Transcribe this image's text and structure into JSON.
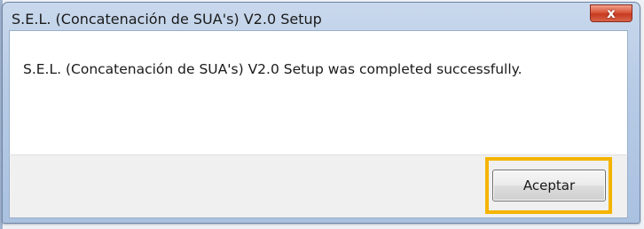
{
  "window": {
    "title": "S.E.L. (Concatenación de SUA's) V2.0 Setup",
    "close_glyph": "x"
  },
  "dialog": {
    "message": "S.E.L. (Concatenación de SUA's) V2.0 Setup was completed successfully."
  },
  "buttons": {
    "accept_label": "Aceptar"
  },
  "colors": {
    "highlight": "#f5b400",
    "close_button": "#c73a1f"
  },
  "icons": {
    "close": "close-icon"
  }
}
